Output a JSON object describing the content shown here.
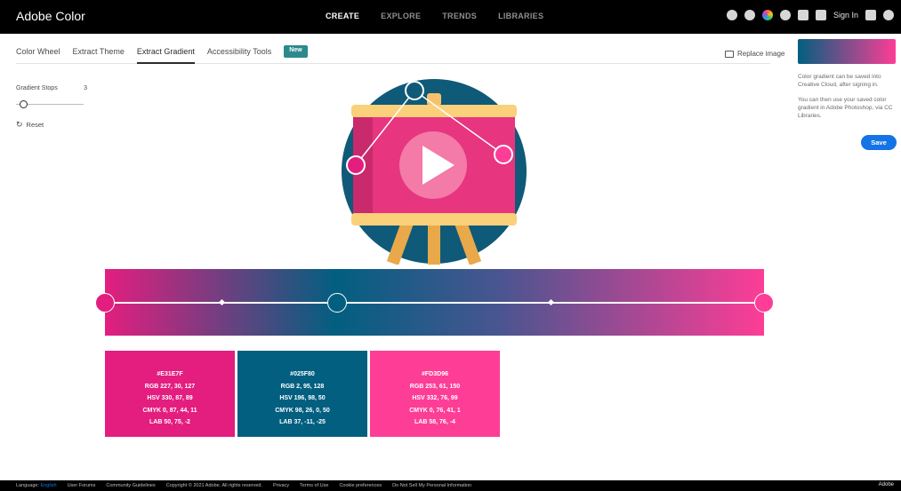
{
  "app": {
    "title": "Adobe Color"
  },
  "topnav": {
    "items": [
      "CREATE",
      "EXPLORE",
      "TRENDS",
      "LIBRARIES"
    ]
  },
  "header": {
    "sign_in": "Sign In"
  },
  "tabs": [
    "Color Wheel",
    "Extract Theme",
    "Extract Gradient",
    "Accessibility Tools"
  ],
  "badge": {
    "new": "New"
  },
  "toolbar": {
    "replace_image": "Replace image"
  },
  "controls": {
    "gradient_stops_label": "Gradient Stops",
    "gradient_stops_value": "3",
    "reset_label": "Reset"
  },
  "swatches": [
    {
      "hex": "#E31E7F",
      "rgb": "RGB 227, 30, 127",
      "hsv": "HSV 330, 87, 89",
      "cmyk": "CMYK 0, 87, 44, 11",
      "lab": "LAB 50, 75, -2",
      "color": "#E31E7F"
    },
    {
      "hex": "#025F80",
      "rgb": "RGB 2, 95, 128",
      "hsv": "HSV 196, 98, 50",
      "cmyk": "CMYK 98, 26, 0, 50",
      "lab": "LAB 37, -11, -25",
      "color": "#025F80"
    },
    {
      "hex": "#FD3D96",
      "rgb": "RGB 253, 61, 150",
      "hsv": "HSV 332, 76, 99",
      "cmyk": "CMYK 0, 76, 41, 1",
      "lab": "LAB 58, 76, -4",
      "color": "#FD3D96"
    }
  ],
  "right_panel": {
    "text1": "Color gradient can be saved into Creative Cloud, after signing in.",
    "text2": "You can then use your saved color gradient in Adobe Photoshop, via CC Libraries.",
    "save": "Save"
  },
  "footer": {
    "language_label": "Language:",
    "language_value": "English",
    "links": [
      "User Forums",
      "Community Guidelines",
      "Copyright © 2021 Adobe. All rights reserved.",
      "Privacy",
      "Terms of Use",
      "Cookie preferences",
      "Do Not Sell My Personal Information"
    ],
    "brand": "Adobe"
  }
}
